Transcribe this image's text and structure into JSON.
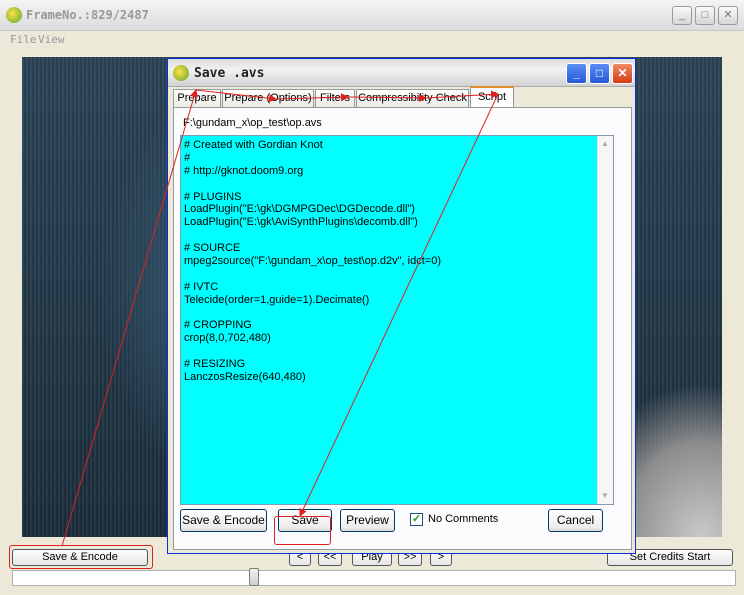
{
  "main_window": {
    "title": "FrameNo.:829/2487",
    "menu": [
      "File",
      "View"
    ],
    "save_encode": "Save & Encode",
    "nav": [
      "<",
      "<<",
      "Play",
      ">>",
      ">"
    ],
    "set_credits": "Set Credits Start"
  },
  "dialog": {
    "title": "Save .avs",
    "tabs": [
      "Prepare",
      "Prepare (Options)",
      "Filters",
      "Compressibility Check",
      "Script"
    ],
    "active_tab": "Script",
    "path": "F:\\gundam_x\\op_test\\op.avs",
    "script_lines": [
      "# Created with Gordian Knot",
      "#",
      "# http://gknot.doom9.org",
      "",
      "#  PLUGINS",
      "LoadPlugin(\"E:\\gk\\DGMPGDec\\DGDecode.dll\")",
      "LoadPlugin(\"E:\\gk\\AviSynthPlugins\\decomb.dll\")",
      "",
      "#  SOURCE",
      "mpeg2source(\"F:\\gundam_x\\op_test\\op.d2v\", idct=0)",
      "",
      "#  IVTC",
      "Telecide(order=1,guide=1).Decimate()",
      "",
      "#  CROPPING",
      "crop(8,0,702,480)",
      "",
      "#  RESIZING",
      "LanczosResize(640,480)"
    ],
    "buttons": {
      "save_encode": "Save & Encode",
      "save": "Save",
      "preview": "Preview",
      "cancel": "Cancel"
    },
    "no_comments": {
      "label": "No Comments",
      "checked": true
    }
  },
  "colors": {
    "script_bg": "#00ffff",
    "annotation": "#e02020",
    "active_tab_accent": "#e68b2c",
    "close_button": "#e0502a"
  }
}
